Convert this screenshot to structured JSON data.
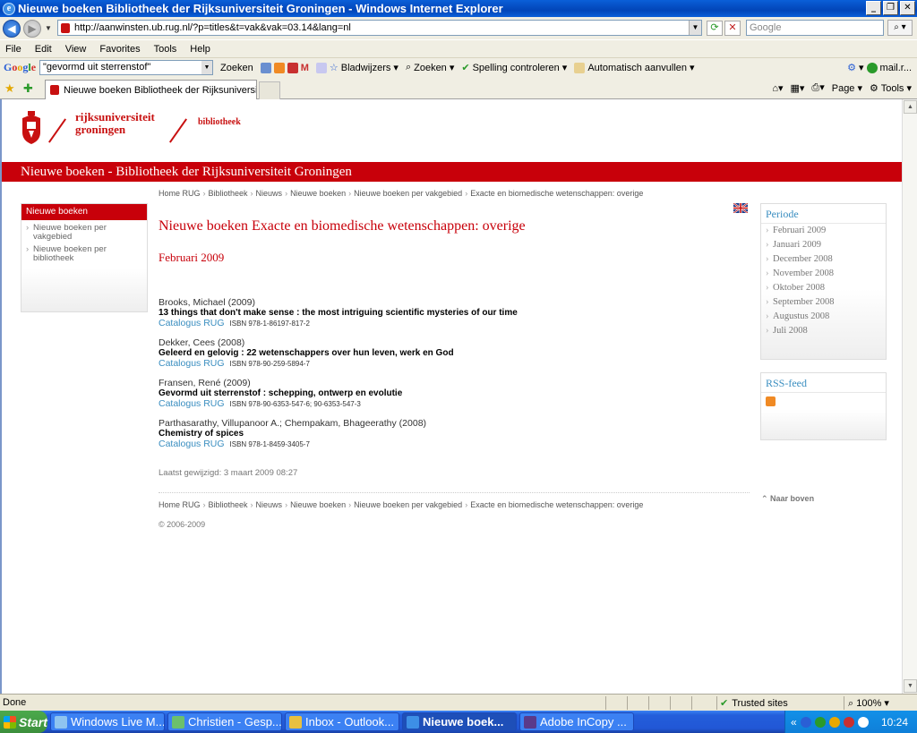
{
  "window": {
    "title": "Nieuwe boeken Bibliotheek der Rijksuniversiteit Groningen - Windows Internet Explorer",
    "address": "http://aanwinsten.ub.rug.nl/?p=titles&t=vak&vak=03.14&lang=nl",
    "search_placeholder": "Google"
  },
  "menu": [
    "File",
    "Edit",
    "View",
    "Favorites",
    "Tools",
    "Help"
  ],
  "google_toolbar": {
    "query": "\"gevormd uit sterrenstof\"",
    "zoeken": "Zoeken",
    "bladwijzers": "Bladwijzers",
    "zoeken2": "Zoeken",
    "spelling": "Spelling controleren",
    "autofill": "Automatisch aanvullen",
    "mail": "mail.r..."
  },
  "tab": {
    "title": "Nieuwe boeken Bibliotheek der Rijksuniversit...",
    "page_label": "Page",
    "tools_label": "Tools"
  },
  "site": {
    "logo_line1": "rijksuniversiteit",
    "logo_line2": "groningen",
    "library": "bibliotheek",
    "banner": "Nieuwe boeken - Bibliotheek der Rijksuniversiteit Groningen"
  },
  "breadcrumbs": [
    "Home RUG",
    "Bibliotheek",
    "Nieuws",
    "Nieuwe boeken",
    "Nieuwe boeken per vakgebied",
    "Exacte en biomedische wetenschappen: overige"
  ],
  "left_nav": {
    "header": "Nieuwe boeken",
    "items": [
      "Nieuwe boeken per vakgebied",
      "Nieuwe boeken per bibliotheek"
    ]
  },
  "main": {
    "heading": "Nieuwe boeken Exacte en biomedische wetenschappen: overige",
    "month": "Februari 2009",
    "books": [
      {
        "author": "Brooks, Michael (2009)",
        "title": "13 things that don't make sense : the most intriguing scientific mysteries of our time",
        "catalog": "Catalogus RUG",
        "isbn": "ISBN 978-1-86197-817-2"
      },
      {
        "author": "Dekker, Cees (2008)",
        "title": "Geleerd en gelovig : 22 wetenschappers over hun leven, werk en God",
        "catalog": "Catalogus RUG",
        "isbn": "ISBN 978-90-259-5894-7"
      },
      {
        "author": "Fransen, René (2009)",
        "title": "Gevormd uit sterrenstof : schepping, ontwerp en evolutie",
        "catalog": "Catalogus RUG",
        "isbn": "ISBN 978-90-6353-547-6; 90-6353-547-3"
      },
      {
        "author": "Parthasarathy, Villupanoor A.; Chempakam, Bhageerathy (2008)",
        "title": "Chemistry of spices",
        "catalog": "Catalogus RUG",
        "isbn": "ISBN 978-1-8459-3405-7"
      }
    ],
    "modified": "Laatst gewijzigd: 3 maart 2009 08:27",
    "naar_boven": "Naar boven",
    "copyright": "© 2006-2009"
  },
  "periode": {
    "header": "Periode",
    "items": [
      "Februari 2009",
      "Januari 2009",
      "December 2008",
      "November 2008",
      "Oktober 2008",
      "September 2008",
      "Augustus 2008",
      "Juli 2008"
    ]
  },
  "rss": {
    "header": "RSS-feed"
  },
  "status": {
    "text": "Done",
    "zone": "Trusted sites",
    "zoom": "100%"
  },
  "taskbar": {
    "start": "Start",
    "tasks": [
      "Windows Live M...",
      "Christien - Gesp...",
      "Inbox - Outlook...",
      "Nieuwe boek...",
      "Adobe InCopy ..."
    ],
    "clock": "10:24"
  }
}
